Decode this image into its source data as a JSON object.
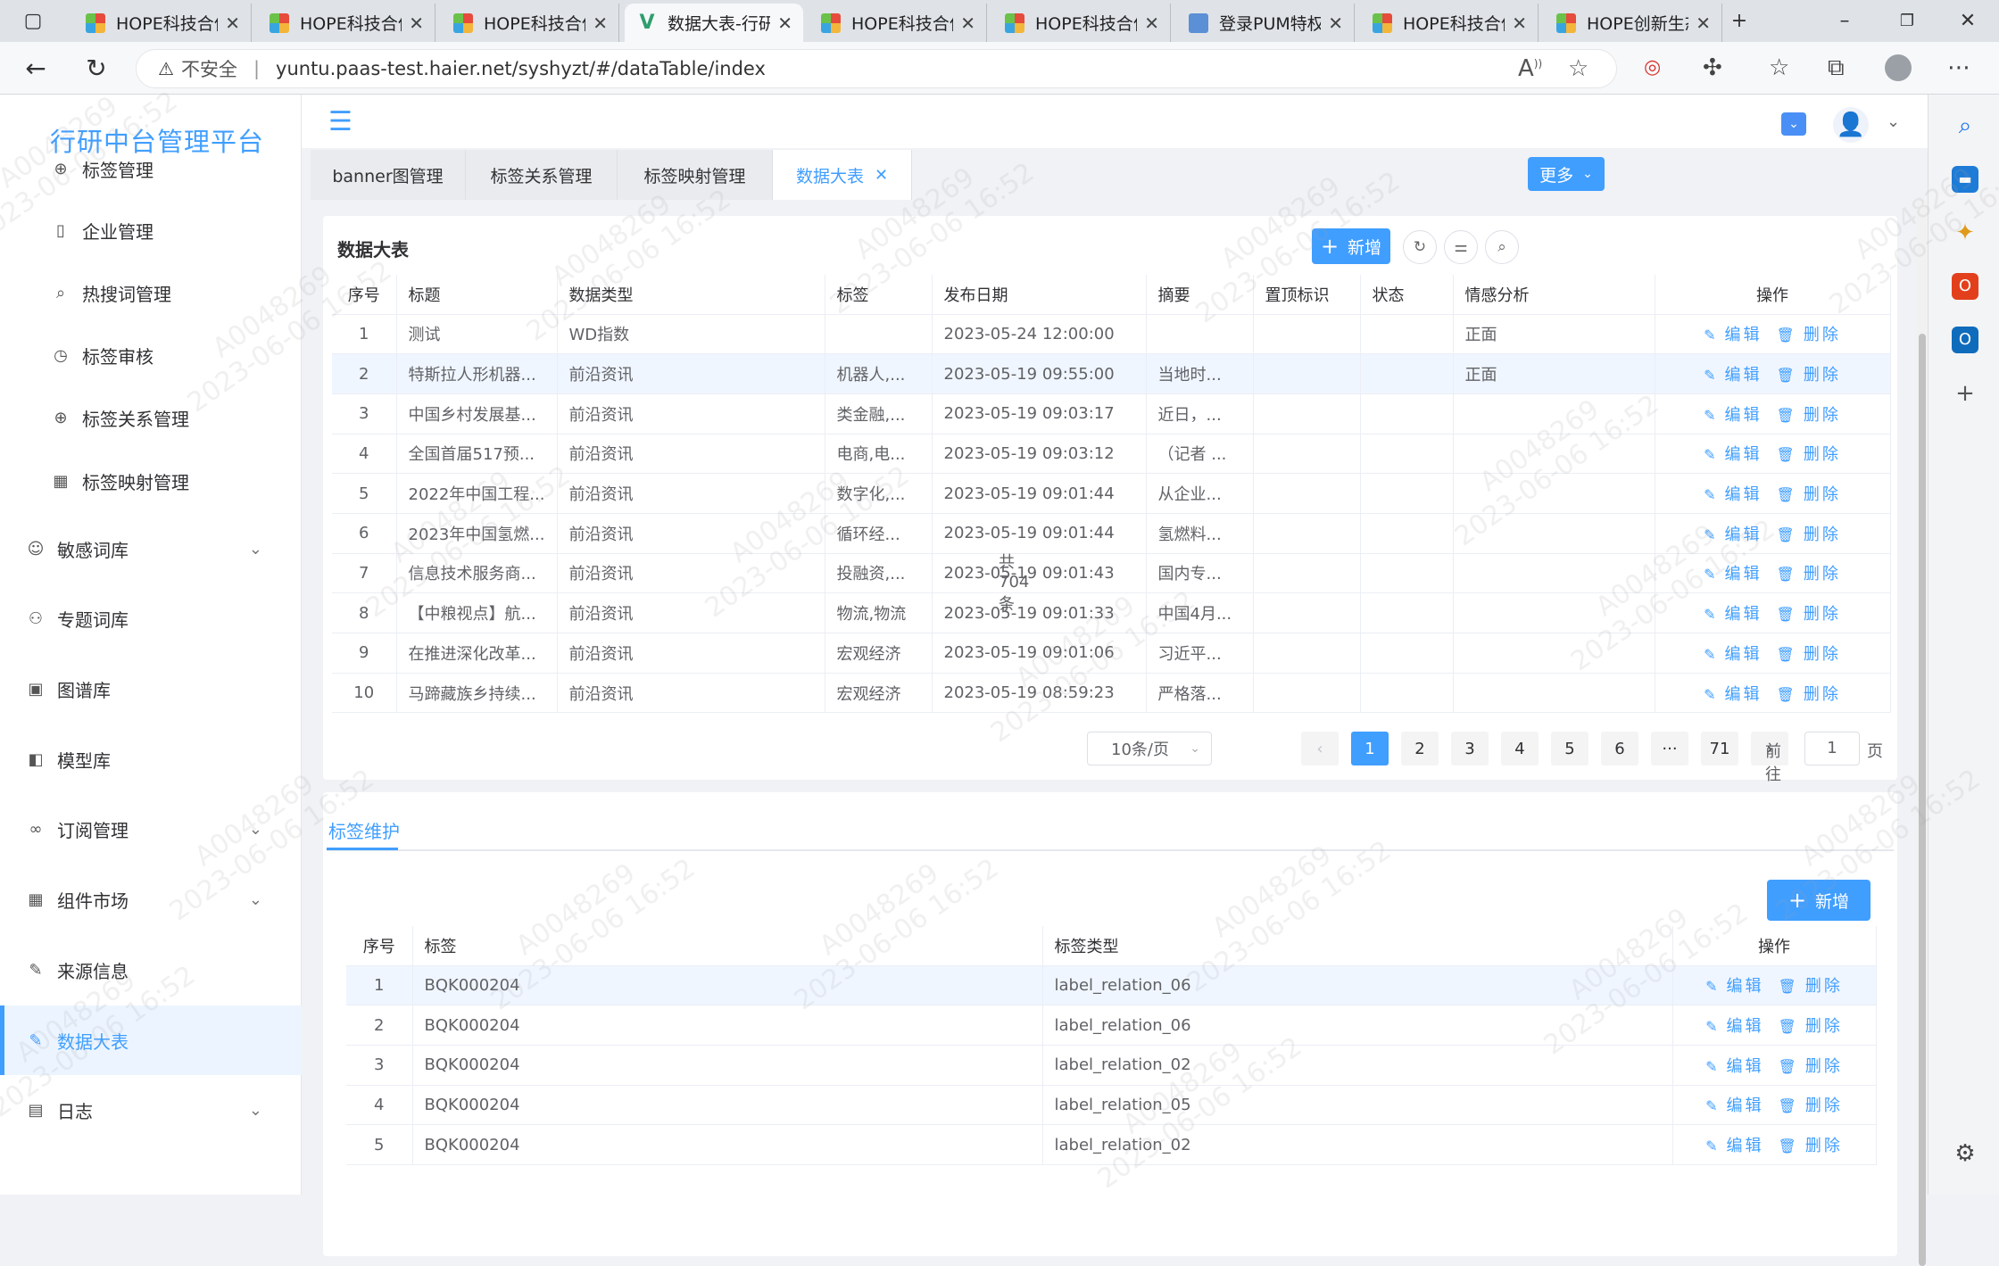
{
  "browser": {
    "tabs": [
      {
        "title": "HOPE科技合作",
        "icon": "hope-icon",
        "active": false
      },
      {
        "title": "HOPE科技合作",
        "icon": "hope-icon",
        "active": false
      },
      {
        "title": "HOPE科技合作",
        "icon": "hope-icon",
        "active": false
      },
      {
        "title": "数据大表-行研",
        "icon": "vue-icon",
        "active": true
      },
      {
        "title": "HOPE科技合作",
        "icon": "hope-icon",
        "active": false
      },
      {
        "title": "HOPE科技合作",
        "icon": "hope-icon",
        "active": false
      },
      {
        "title": "登录PUM特权",
        "icon": "login-icon",
        "active": false
      },
      {
        "title": "HOPE科技合作",
        "icon": "hope-icon",
        "active": false
      },
      {
        "title": "HOPE创新生态",
        "icon": "hope-icon",
        "active": false
      }
    ],
    "insecure_label": "不安全",
    "url": "yuntu.paas-test.haier.net/syshyzt/#/dataTable/index"
  },
  "app": {
    "brand": "行研中台管理平台",
    "menu": [
      {
        "label": "标签管理",
        "icon": "plus-circle-icon",
        "level": "sub"
      },
      {
        "label": "企业管理",
        "icon": "document-icon",
        "level": "sub"
      },
      {
        "label": "热搜词管理",
        "icon": "search-doc-icon",
        "level": "sub"
      },
      {
        "label": "标签审核",
        "icon": "clock-icon",
        "level": "sub"
      },
      {
        "label": "标签关系管理",
        "icon": "plus-circle-icon",
        "level": "sub"
      },
      {
        "label": "标签映射管理",
        "icon": "grid-icon",
        "level": "sub"
      },
      {
        "label": "敏感词库",
        "icon": "mask-icon",
        "level": "top",
        "expandable": true
      },
      {
        "label": "专题词库",
        "icon": "tree-icon",
        "level": "top"
      },
      {
        "label": "图谱库",
        "icon": "image-icon",
        "level": "top"
      },
      {
        "label": "模型库",
        "icon": "model-icon",
        "level": "top"
      },
      {
        "label": "订阅管理",
        "icon": "glasses-icon",
        "level": "top",
        "expandable": true
      },
      {
        "label": "组件市场",
        "icon": "grid-icon",
        "level": "top",
        "expandable": true
      },
      {
        "label": "来源信息",
        "icon": "edit-doc-icon",
        "level": "top"
      },
      {
        "label": "数据大表",
        "icon": "edit-doc-icon",
        "level": "top",
        "active": true
      },
      {
        "label": "日志",
        "icon": "log-icon",
        "level": "top",
        "expandable": true
      }
    ],
    "tags_view": [
      {
        "label": "banner图管理",
        "active": false
      },
      {
        "label": "标签关系管理",
        "active": false
      },
      {
        "label": "标签映射管理",
        "active": false
      },
      {
        "label": "数据大表",
        "active": true
      }
    ],
    "more_label": "更多"
  },
  "data_table": {
    "title": "数据大表",
    "add_label": "新增",
    "columns": [
      "序号",
      "标题",
      "数据类型",
      "标签",
      "发布日期",
      "摘要",
      "置顶标识",
      "状态",
      "情感分析",
      "操作"
    ],
    "edit_label": "编辑",
    "delete_label": "删除",
    "rows": [
      [
        "1",
        "测试",
        "WD指数",
        "",
        "2023-05-24 12:00:00",
        "",
        "",
        "",
        "正面"
      ],
      [
        "2",
        "特斯拉人形机器...",
        "前沿资讯",
        "机器人,...",
        "2023-05-19 09:55:00",
        "当地时...",
        "",
        "",
        "正面"
      ],
      [
        "3",
        "中国乡村发展基...",
        "前沿资讯",
        "类金融,...",
        "2023-05-19 09:03:17",
        "近日，...",
        "",
        "",
        ""
      ],
      [
        "4",
        "全国首届517预...",
        "前沿资讯",
        "电商,电...",
        "2023-05-19 09:03:12",
        "（记者 ...",
        "",
        "",
        ""
      ],
      [
        "5",
        "2022年中国工程...",
        "前沿资讯",
        "数字化,...",
        "2023-05-19 09:01:44",
        "从企业...",
        "",
        "",
        ""
      ],
      [
        "6",
        "2023年中国氢燃...",
        "前沿资讯",
        "循环经...",
        "2023-05-19 09:01:44",
        "氢燃料...",
        "",
        "",
        ""
      ],
      [
        "7",
        "信息技术服务商...",
        "前沿资讯",
        "投融资,...",
        "2023-05-19 09:01:43",
        "国内专...",
        "",
        "",
        ""
      ],
      [
        "8",
        "【中粮视点】航...",
        "前沿资讯",
        "物流,物流",
        "2023-05-19 09:01:33",
        "中国4月...",
        "",
        "",
        ""
      ],
      [
        "9",
        "在推进深化改革...",
        "前沿资讯",
        "宏观经济",
        "2023-05-19 09:01:06",
        "习近平...",
        "",
        "",
        ""
      ],
      [
        "10",
        "马蹄藏族乡持续...",
        "前沿资讯",
        "宏观经济",
        "2023-05-19 08:59:23",
        "严格落...",
        "",
        "",
        ""
      ]
    ],
    "highlighted_row": 2,
    "pagination": {
      "total_label": "共 704 条",
      "page_size": "10条/页",
      "pages": [
        "1",
        "2",
        "3",
        "4",
        "5",
        "6",
        "···",
        "71"
      ],
      "current_page": 1,
      "goto_label": "前往",
      "goto_value": "1",
      "goto_unit": "页"
    }
  },
  "tag_maintenance": {
    "tab_label": "标签维护",
    "add_label": "新增",
    "columns": [
      "序号",
      "标签",
      "标签类型",
      "操作"
    ],
    "edit_label": "编辑",
    "delete_label": "删除",
    "rows": [
      [
        "1",
        "BQK000204",
        "label_relation_06"
      ],
      [
        "2",
        "BQK000204",
        "label_relation_06"
      ],
      [
        "3",
        "BQK000204",
        "label_relation_02"
      ],
      [
        "4",
        "BQK000204",
        "label_relation_05"
      ],
      [
        "5",
        "BQK000204",
        "label_relation_02"
      ]
    ],
    "highlighted_row": 1
  },
  "watermark": {
    "id": "A0048269",
    "time": "2023-06-06 16:52"
  },
  "colors": {
    "primary": "#409eff",
    "sidebar_active_bg": "#ecf5ff",
    "row_highlight": "#f0f6ff"
  }
}
